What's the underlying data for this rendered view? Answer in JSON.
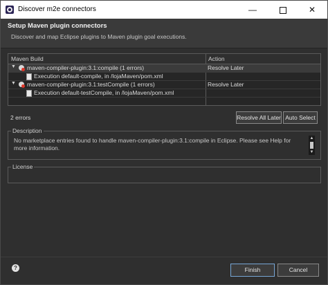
{
  "window": {
    "title": "Discover m2e connectors"
  },
  "header": {
    "title": "Setup Maven plugin connectors",
    "description": "Discover and map Eclipse plugins to Maven plugin goal executions."
  },
  "table": {
    "columns": [
      "Maven Build",
      "Action"
    ],
    "rows": [
      {
        "label": "maven-compiler-plugin:3.1:compile (1 errors)",
        "action": "Resolve Later",
        "icon": "error-icon"
      },
      {
        "label": "Execution default-compile, in /lojaMaven/pom.xml",
        "action": "",
        "icon": "pom-file-icon"
      },
      {
        "label": "maven-compiler-plugin:3.1:testCompile (1 errors)",
        "action": "Resolve Later",
        "icon": "error-icon"
      },
      {
        "label": "Execution default-testCompile, in /lojaMaven/pom.xml",
        "action": "",
        "icon": "pom-file-icon"
      }
    ]
  },
  "status": {
    "error_count": "2 errors"
  },
  "buttons": {
    "resolve_all": "Resolve All Later",
    "auto_select": "Auto Select",
    "finish": "Finish",
    "cancel": "Cancel"
  },
  "description": {
    "legend": "Description",
    "text": "No marketplace entries found to handle maven-compiler-plugin:3.1:compile in Eclipse.  Please see Help for more information."
  },
  "license": {
    "legend": "License"
  },
  "footer": {
    "help_icon": "?"
  }
}
